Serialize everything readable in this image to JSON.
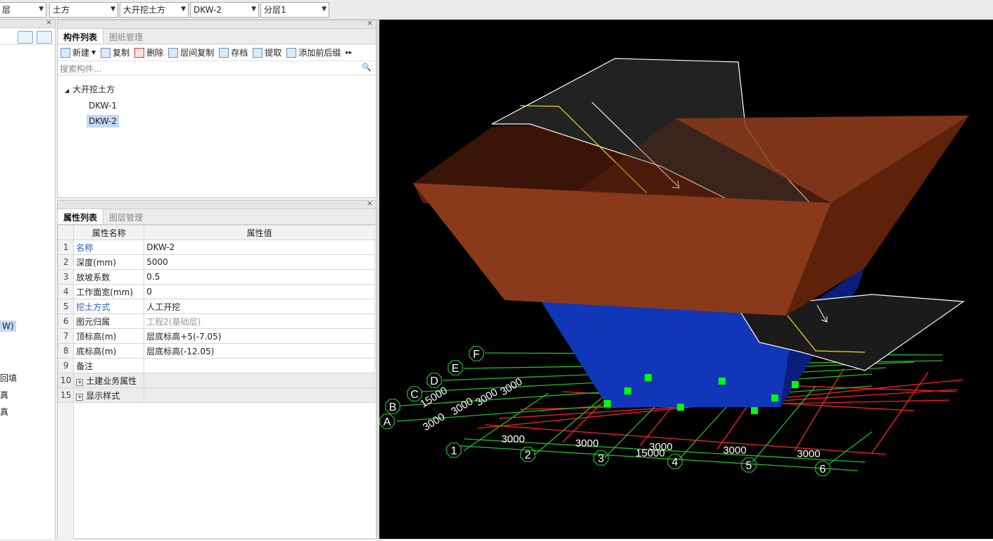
{
  "topbar": {
    "combos": [
      {
        "value": "层"
      },
      {
        "value": "土方"
      },
      {
        "value": "大开挖土方"
      },
      {
        "value": "DKW-2"
      },
      {
        "value": "分层1"
      }
    ]
  },
  "left_strip": {
    "items": [
      "W)",
      "回填",
      "真",
      "真"
    ]
  },
  "component_panel": {
    "tabs": [
      "构件列表",
      "图纸管理"
    ],
    "toolbar": [
      "新建",
      "复制",
      "删除",
      "层间复制",
      "存档",
      "提取",
      "添加前后缀"
    ],
    "search_placeholder": "搜索构件...",
    "tree": {
      "root": "大开挖土方",
      "children": [
        "DKW-1",
        "DKW-2"
      ],
      "selected": "DKW-2"
    }
  },
  "property_panel": {
    "tabs": [
      "属性列表",
      "图层管理"
    ],
    "headers": [
      "属性名称",
      "属性值"
    ],
    "rows": [
      {
        "n": "1",
        "name": "名称",
        "value": "DKW-2",
        "blue": true
      },
      {
        "n": "2",
        "name": "深度(mm)",
        "value": "5000"
      },
      {
        "n": "3",
        "name": "放坡系数",
        "value": "0.5"
      },
      {
        "n": "4",
        "name": "工作面宽(mm)",
        "value": "0"
      },
      {
        "n": "5",
        "name": "挖土方式",
        "value": "人工开挖",
        "blue": true
      },
      {
        "n": "6",
        "name": "图元归属",
        "value": "工程2(基础层)",
        "gray": true
      },
      {
        "n": "7",
        "name": "顶标高(m)",
        "value": "层底标高+5(-7.05)"
      },
      {
        "n": "8",
        "name": "底标高(m)",
        "value": "层底标高(-12.05)"
      },
      {
        "n": "9",
        "name": "备注",
        "value": ""
      }
    ],
    "groups": [
      {
        "n": "10",
        "name": "土建业务属性"
      },
      {
        "n": "15",
        "name": "显示样式"
      }
    ]
  },
  "viewport": {
    "axis_letters": [
      "A",
      "B",
      "C",
      "D",
      "E",
      "F"
    ],
    "axis_numbers": [
      "1",
      "2",
      "3",
      "4",
      "5",
      "6"
    ],
    "dims": [
      "3000",
      "3000",
      "3000",
      "3000",
      "3000",
      "15000",
      "15000",
      "3000",
      "3000",
      "3000",
      "3000"
    ]
  },
  "colors": {
    "pit": "#8a3a1a",
    "fill": "#1136b8",
    "ramp": "#1b1b1b",
    "grid_red": "#ff2020",
    "grid_green": "#20c020",
    "grip": "#00ff00"
  }
}
